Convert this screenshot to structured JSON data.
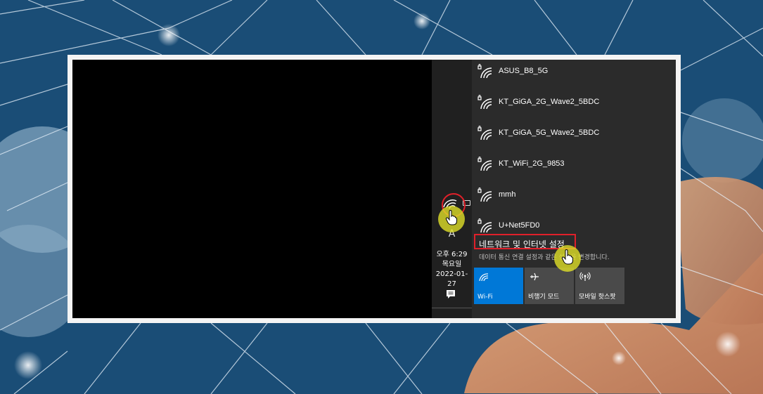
{
  "wifi_networks": [
    {
      "name": "ASUS_B8_5G",
      "icon": "wifi-secured-icon"
    },
    {
      "name": "KT_GiGA_2G_Wave2_5BDC",
      "icon": "wifi-secured-icon"
    },
    {
      "name": "KT_GiGA_5G_Wave2_5BDC",
      "icon": "wifi-secured-icon"
    },
    {
      "name": "KT_WiFi_2G_9853",
      "icon": "wifi-secured-icon"
    },
    {
      "name": "mmh",
      "icon": "wifi-secured-icon"
    },
    {
      "name": "U+Net5FD0",
      "icon": "wifi-secured-icon"
    }
  ],
  "settings": {
    "link": "네트워크 및 인터넷 설정",
    "description": "데이터 통신 연결 설정과 같은 설정을 변경합니다."
  },
  "quick_actions": [
    {
      "label": "Wi-Fi",
      "icon": "wifi-icon",
      "active": true
    },
    {
      "label": "비행기 모드",
      "icon": "airplane-icon",
      "active": false
    },
    {
      "label": "모바일 핫스팟",
      "icon": "hotspot-icon",
      "active": false
    }
  ],
  "taskbar": {
    "ime": "A",
    "time": "오후 6:29",
    "day": "목요일",
    "date": "2022-01-27",
    "tray_icon": "wifi-tray-icon",
    "notification_icon": "notification-icon"
  },
  "colors": {
    "accent": "#0078d7",
    "highlight": "#e0202a",
    "cursor_halo": "#dede28",
    "flyout_bg": "#2b2b2b",
    "taskbar_bg": "#202020"
  }
}
